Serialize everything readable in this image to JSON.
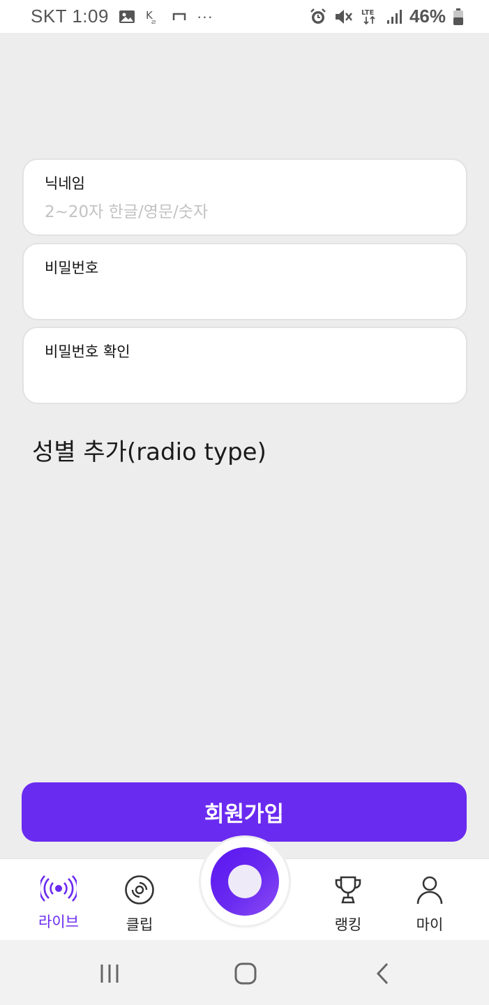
{
  "status_bar": {
    "carrier_time": "SKT 1:09",
    "more": "···",
    "battery": "46%",
    "network": "LTE"
  },
  "form": {
    "nickname": {
      "label": "닉네임",
      "placeholder": "2~20자 한글/영문/숫자",
      "value": ""
    },
    "password": {
      "label": "비밀번호",
      "placeholder": "",
      "value": ""
    },
    "password_confirm": {
      "label": "비밀번호 확인",
      "placeholder": "",
      "value": ""
    },
    "gender_note": "성별 추가(radio type)"
  },
  "signup_button": "회원가입",
  "bottom_nav": {
    "live": "라이브",
    "clip": "클립",
    "ranking": "랭킹",
    "my": "마이",
    "active": "live"
  },
  "colors": {
    "accent": "#6a2bf0",
    "background": "#ededed"
  },
  "icons": {
    "live": "broadcast-icon",
    "clip": "disc-icon",
    "ranking": "trophy-icon",
    "my": "person-icon",
    "center": "record-icon"
  }
}
